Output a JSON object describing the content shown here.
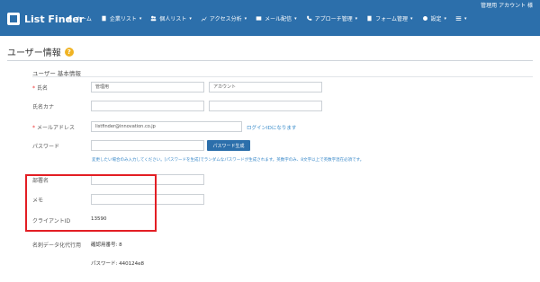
{
  "header": {
    "logo_text": "List Finder",
    "account_label": "管理用 アカウント 様",
    "nav": [
      {
        "label": "ホーム",
        "icon": "home-icon"
      },
      {
        "label": "企業リスト",
        "icon": "building-icon",
        "caret": "▾"
      },
      {
        "label": "個人リスト",
        "icon": "users-icon",
        "caret": "▾"
      },
      {
        "label": "アクセス分析",
        "icon": "chart-icon",
        "caret": "▾"
      },
      {
        "label": "メール配信",
        "icon": "mail-icon",
        "caret": "▾"
      },
      {
        "label": "アプローチ管理",
        "icon": "phone-icon",
        "caret": "▾"
      },
      {
        "label": "フォーム管理",
        "icon": "form-icon",
        "caret": "▾"
      },
      {
        "label": "設定",
        "icon": "gear-icon",
        "caret": "▾"
      },
      {
        "label": "",
        "icon": "menu-icon",
        "caret": "▾"
      }
    ]
  },
  "page": {
    "title": "ユーザー情報",
    "help_icon_glyph": "?",
    "section_title": "ユーザー 基本情報",
    "required_mark": "*"
  },
  "form": {
    "name_label": "氏名",
    "name_last": "管理用",
    "name_first": "アカウント",
    "kana_label": "氏名カナ",
    "kana_last": "",
    "kana_first": "",
    "email_label": "メールアドレス",
    "email_value": "listfinder@innovation.co.jp",
    "login_link": "ログインIDになります",
    "password_label": "パスワード",
    "password_value": "",
    "password_button": "パスワード生成",
    "password_hint": "変更したい場合のみ入力してください。[パスワードを生成]でランダムなパスワードが生成されます。英数字のみ、8文字以上で英数字混在必須です。",
    "department_label": "部署名",
    "department_value": "",
    "memo_label": "メモ",
    "memo_value": "",
    "client_id_label": "クライアントID",
    "client_id_value": "13590",
    "service_label": "名刺データ化代行用",
    "auth_number": "確認用番号: 8",
    "service_password": "パスワード: 440124e8"
  },
  "colors": {
    "header_bg": "#2c6fab",
    "highlight_border": "#e31e24",
    "link": "#2f86c8",
    "help": "#f0b323"
  }
}
